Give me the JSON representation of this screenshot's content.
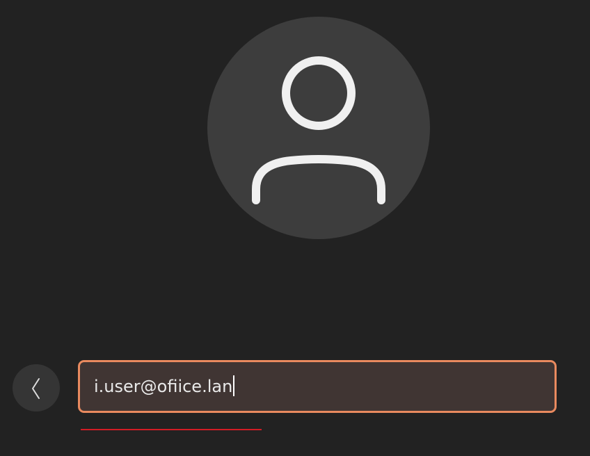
{
  "login": {
    "avatar_icon": "user-silhouette-icon",
    "back_icon": "chevron-left-icon",
    "username": "i.user@ofiice.lan",
    "accent_color": "#e98a5f",
    "progress_color": "#d21c25"
  }
}
